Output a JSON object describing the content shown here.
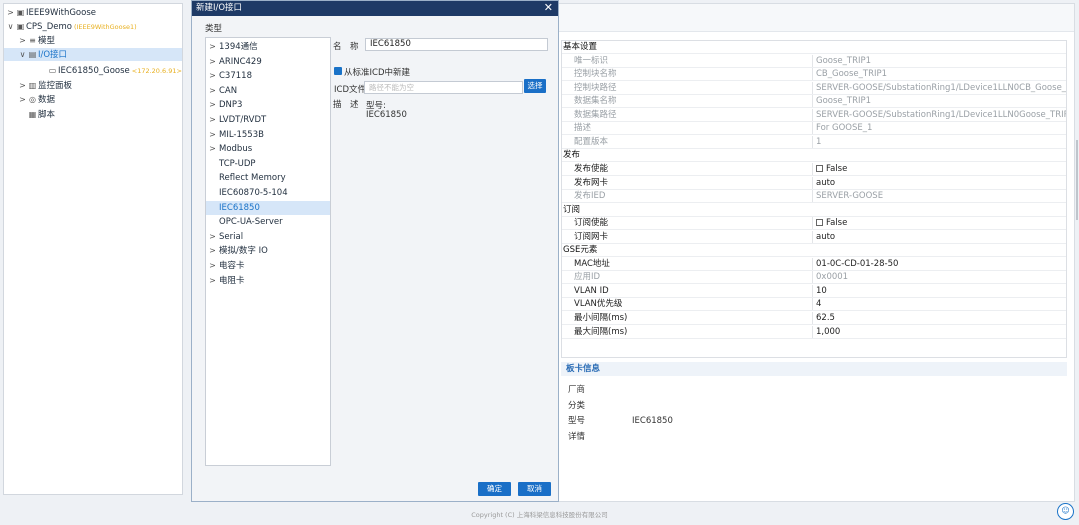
{
  "tree": {
    "items": [
      {
        "arrow": ">",
        "icon": "▣",
        "icon_name": "project-icon",
        "label": "IEEE9WithGoose",
        "sub": ""
      },
      {
        "arrow": "∨",
        "icon": "▣",
        "icon_name": "project-icon",
        "label": "CPS_Demo",
        "sub": "(IEEE9WithGoose1)"
      },
      {
        "arrow": ">",
        "icon": "≡",
        "icon_name": "list-icon",
        "label": "模型",
        "sub": ""
      },
      {
        "arrow": "∨",
        "icon": "▤",
        "icon_name": "io-icon",
        "label": "I/O接口",
        "sub": ""
      },
      {
        "arrow": "",
        "icon": "▭",
        "icon_name": "device-icon",
        "label": "IEC61850_Goose",
        "sub": "<172.20.6.91>"
      },
      {
        "arrow": ">",
        "icon": "▥",
        "icon_name": "chart-icon",
        "label": "监控面板",
        "sub": ""
      },
      {
        "arrow": ">",
        "icon": "◎",
        "icon_name": "data-icon",
        "label": "数据",
        "sub": ""
      },
      {
        "arrow": "",
        "icon": "▦",
        "icon_name": "script-icon",
        "label": "脚本",
        "sub": ""
      }
    ]
  },
  "dialog": {
    "title": "新建I/O接口",
    "type_label": "类型",
    "types": [
      {
        "arrow": ">",
        "label": "1394通信"
      },
      {
        "arrow": ">",
        "label": "ARINC429"
      },
      {
        "arrow": ">",
        "label": "C37118"
      },
      {
        "arrow": ">",
        "label": "CAN"
      },
      {
        "arrow": ">",
        "label": "DNP3"
      },
      {
        "arrow": ">",
        "label": "LVDT/RVDT"
      },
      {
        "arrow": ">",
        "label": "MIL-1553B"
      },
      {
        "arrow": ">",
        "label": "Modbus"
      },
      {
        "arrow": "",
        "label": "TCP-UDP"
      },
      {
        "arrow": "",
        "label": "Reflect Memory"
      },
      {
        "arrow": "",
        "label": "IEC60870-5-104"
      },
      {
        "arrow": "",
        "label": "IEC61850"
      },
      {
        "arrow": "",
        "label": "OPC-UA-Server"
      },
      {
        "arrow": ">",
        "label": "Serial"
      },
      {
        "arrow": ">",
        "label": "模拟/数字 IO"
      },
      {
        "arrow": ">",
        "label": "电容卡"
      },
      {
        "arrow": ">",
        "label": "电阻卡"
      }
    ],
    "name_label": "名　称",
    "name_value": "IEC61850",
    "icd_checkbox_label": "从标准ICD中新建",
    "icd_file_label": "ICD文件",
    "icd_file_placeholder": "路径不能为空",
    "select_button": "选择",
    "desc_label": "描　述",
    "desc_model_label": "型号:",
    "desc_model_value": "IEC61850",
    "ok_button": "确定",
    "cancel_button": "取消"
  },
  "props": {
    "rows": [
      {
        "cat": true,
        "k": "基本设置"
      },
      {
        "k": "唯一标识",
        "v": "Goose_TRIP1",
        "dis": true
      },
      {
        "k": "控制块名称",
        "v": "CB_Goose_TRIP1",
        "dis": true
      },
      {
        "k": "控制块路径",
        "v": "SERVER-GOOSE/SubstationRing1/LDevice1LLN0CB_Goose_TRIP1",
        "dis": true
      },
      {
        "k": "数据集名称",
        "v": "Goose_TRIP1",
        "dis": true
      },
      {
        "k": "数据集路径",
        "v": "SERVER-GOOSE/SubstationRing1/LDevice1LLN0Goose_TRIP1",
        "dis": true
      },
      {
        "k": "描述",
        "v": "For GOOSE_1",
        "dis": true
      },
      {
        "k": "配置版本",
        "v": "1",
        "dis": true
      },
      {
        "cat": true,
        "k": "发布"
      },
      {
        "k": "发布使能",
        "v": "False",
        "chk": true
      },
      {
        "k": "发布网卡",
        "v": "auto"
      },
      {
        "k": "发布IED",
        "v": "SERVER-GOOSE",
        "dis": true
      },
      {
        "cat": true,
        "k": "订阅"
      },
      {
        "k": "订阅使能",
        "v": "False",
        "chk": true
      },
      {
        "k": "订阅网卡",
        "v": "auto"
      },
      {
        "cat": true,
        "k": "GSE元素"
      },
      {
        "k": "MAC地址",
        "v": "01-0C-CD-01-28-50"
      },
      {
        "k": "应用ID",
        "v": "0x0001",
        "dis": true
      },
      {
        "k": "VLAN ID",
        "v": "10"
      },
      {
        "k": "VLAN优先级",
        "v": "4"
      },
      {
        "k": "最小间隔(ms)",
        "v": "62.5"
      },
      {
        "k": "最大间隔(ms)",
        "v": "1,000"
      }
    ]
  },
  "card": {
    "title": "板卡信息",
    "vendor_label": "厂商",
    "category_label": "分类",
    "model_label": "型号",
    "model_value": "IEC61850",
    "detail_label": "详情"
  },
  "footer": {
    "copyright": "Copyright (C) 上海科梁信息科技股份有限公司"
  },
  "colors": {
    "accent": "#1a73c8",
    "dialog_title_bg": "#1e3a66",
    "subtitle_orange": "#e8b020"
  }
}
